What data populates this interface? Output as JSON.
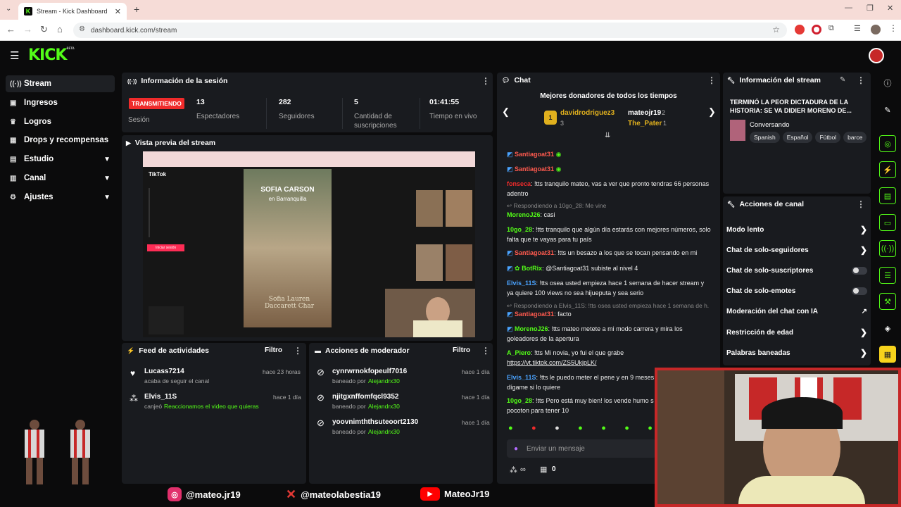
{
  "browser": {
    "tab_title": "Stream - Kick Dashboard",
    "url": "dashboard.kick.com/stream"
  },
  "brand": {
    "logo": "KICK",
    "logo_sup": "BETA",
    "accent": "#53fc18"
  },
  "sidebar": {
    "items": [
      {
        "label": "Stream",
        "icon": "signal-icon"
      },
      {
        "label": "Ingresos",
        "icon": "money-icon"
      },
      {
        "label": "Logros",
        "icon": "trophy-icon"
      },
      {
        "label": "Drops y recompensas",
        "icon": "gift-icon"
      },
      {
        "label": "Estudio",
        "icon": "studio-icon"
      },
      {
        "label": "Canal",
        "icon": "channel-icon"
      },
      {
        "label": "Ajustes",
        "icon": "gear-icon"
      }
    ]
  },
  "session": {
    "title": "Información de la sesión",
    "status_badge": "TRANSMITIENDO",
    "status_label": "Sesión",
    "stats": [
      {
        "value": "13",
        "label": "Espectadores"
      },
      {
        "value": "282",
        "label": "Seguidores"
      },
      {
        "value": "5",
        "label": "Cantidad de suscripciones"
      },
      {
        "value": "01:41:55",
        "label": "Tiempo en vivo"
      }
    ]
  },
  "preview": {
    "title": "Vista previa del stream",
    "overlay_title": "SOFIA CARSON",
    "overlay_sub": "en Barranquilla",
    "overlay_caption": "Sofia Lauren Daccarett Char",
    "tiktok": "TikTok",
    "login_btn": "Iniciar sesión"
  },
  "activity": {
    "title": "Feed de actividades",
    "filter": "Filtro",
    "items": [
      {
        "name": "Lucass7214",
        "time": "hace 23 horas",
        "sub": "acaba de seguir el canal",
        "sub_green": ""
      },
      {
        "name": "Elvis_11S",
        "time": "hace 1 día",
        "sub": "canjeó",
        "sub_green": "Reaccionamos el video que quieras"
      }
    ]
  },
  "modactions": {
    "title": "Acciones de moderador",
    "filter": "Filtro",
    "items": [
      {
        "name": "cynrwrnokfopeulf7016",
        "time": "hace 1 día",
        "by": "baneado por",
        "mod": "Alejandrx30"
      },
      {
        "name": "njitgxnffomfqcl9352",
        "time": "hace 1 día",
        "by": "baneado por",
        "mod": "Alejandrx30"
      },
      {
        "name": "yoovnimththsuteoort2130",
        "time": "hace 1 día",
        "by": "baneado por",
        "mod": "Alejandrx30"
      }
    ]
  },
  "chat": {
    "title": "Chat",
    "donors_title": "Mejores donadores de todos los tiempos",
    "donors": [
      {
        "name": "davidrodriguez3",
        "count": "3"
      },
      {
        "name": "mateojr19",
        "count": "2"
      },
      {
        "name": "The_Pater",
        "count": "1"
      }
    ],
    "messages": [
      {
        "user": "Santiagoat31",
        "color": "#ff5a4e",
        "text": ""
      },
      {
        "user": "Santiagoat31",
        "color": "#ff5a4e",
        "text": ""
      },
      {
        "user": "fonseca",
        "color": "#ef2b2b",
        "text": ": !tts tranquilo mateo, vas a ver que pronto tendras 66 personas adentro"
      },
      {
        "reply": "Respondiendo a 10go_28: Me vine",
        "user": "MorenoJ26",
        "color": "#53fc18",
        "text": ": casi"
      },
      {
        "user": "10go_28",
        "color": "#53fc18",
        "text": ": !tts tranquilo que algún día estarás con mejores números, solo falta que te vayas para tu país"
      },
      {
        "user": "Santiagoat31",
        "color": "#ff5a4e",
        "text": ": !tts un besazo a los que se tocan pensando en mi"
      },
      {
        "user": "BotRix",
        "color": "#53fc18",
        "text": ": @Santiagoat31 subiste al nivel 4"
      },
      {
        "user": "Elvis_11S",
        "color": "#4aa3ff",
        "text": ": !tts osea usted empieza hace 1 semana de hacer stream y ya quiere 100 views no sea hijueputa y sea serio"
      },
      {
        "reply": "Respondiendo a Elvis_11S: !tts osea usted empieza hace 1 semana de h...",
        "user": "Santiagoat31",
        "color": "#ff5a4e",
        "text": ": facto"
      },
      {
        "user": "MorenoJ26",
        "color": "#53fc18",
        "text": ": !tts mateo metete a mi modo carrera y mira los goleadores de la apertura"
      },
      {
        "user": "A_Piero",
        "color": "#53fc18",
        "text": ": !tts Mi novia, yo fui el que grabe",
        "link": "https://vt.tiktok.com/ZS5UkjpLK/"
      },
      {
        "user": "Elvis_11S",
        "color": "#4aa3ff",
        "text": ": !tts le puedo meter el pene y en 9 meses dígame si lo quiere"
      },
      {
        "user": "10go_28",
        "color": "#53fc18",
        "text": ": !tts Pero está muy bien! los vende humo s pocoton para tener 10"
      }
    ],
    "input_placeholder": "Enviar un mensaje",
    "infinite": "∞",
    "points": "0"
  },
  "stream_info": {
    "title": "Información del stream",
    "stream_title": "TERMINÓ LA PEOR DICTADURA DE LA HISTORIA: SE VA DIDIER MORENO DE...",
    "category": "Conversando",
    "tags": [
      "Spanish",
      "Español",
      "Fútbol",
      "barce"
    ]
  },
  "channel_actions": {
    "title": "Acciones de canal",
    "items": [
      {
        "label": "Modo lento",
        "kind": "arrow"
      },
      {
        "label": "Chat de solo-seguidores",
        "kind": "arrow"
      },
      {
        "label": "Chat de solo-suscriptores",
        "kind": "toggle"
      },
      {
        "label": "Chat de solo-emotes",
        "kind": "toggle"
      },
      {
        "label": "Moderación del chat con IA",
        "kind": "ext"
      },
      {
        "label": "Restricción de edad",
        "kind": "arrow"
      },
      {
        "label": "Palabras baneadas",
        "kind": "arrow"
      }
    ]
  },
  "socials": [
    {
      "handle": "@mateo.jr19",
      "icon": "instagram-icon"
    },
    {
      "handle": "@mateolabestia19",
      "icon": "x-icon"
    },
    {
      "handle": "MateoJr19",
      "icon": "youtube-icon"
    }
  ]
}
